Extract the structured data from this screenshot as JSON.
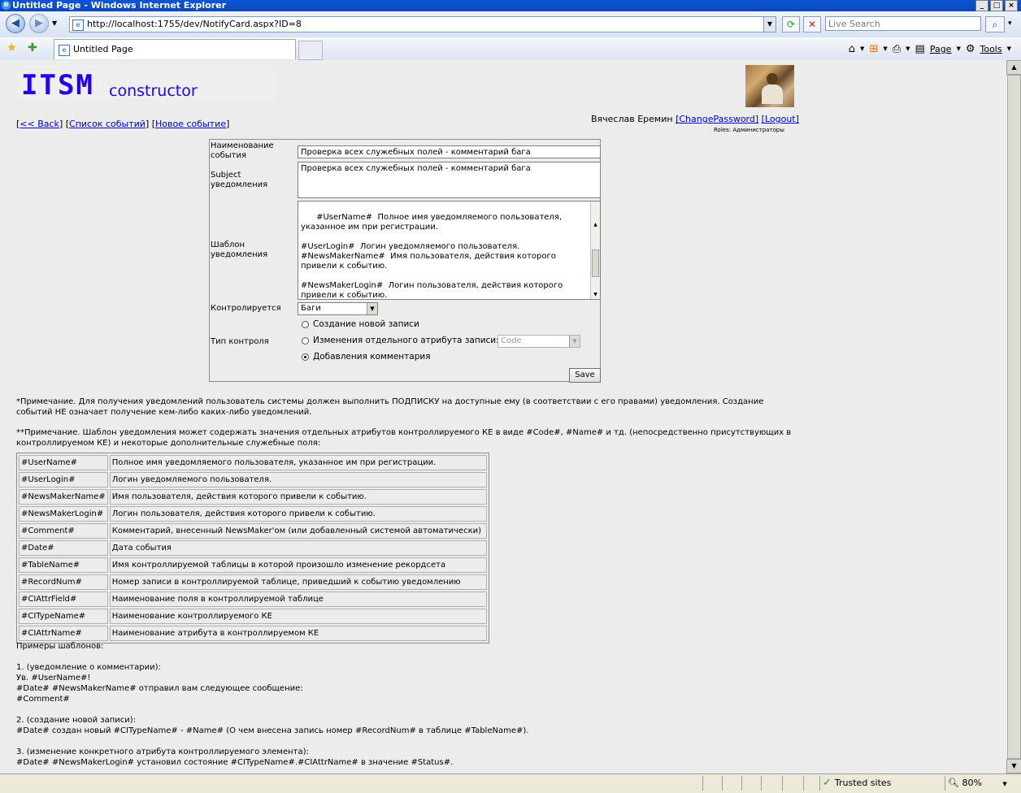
{
  "window": {
    "title": "Untitled Page - Windows Internet Explorer"
  },
  "browser": {
    "address": "http://localhost:1755/dev/NotifyCard.aspx?ID=8",
    "search_placeholder": "Live Search",
    "tab_title": "Untitled Page",
    "commands": {
      "page": "Page",
      "tools": "Tools"
    }
  },
  "status": {
    "zone": "Trusted sites",
    "zoom": "80%"
  },
  "header": {
    "logo_main": "ITSM",
    "logo_sub": "constructor",
    "links": {
      "back": "<< Back",
      "events": "Список событий",
      "new_event": "Новое событие"
    },
    "user": {
      "name": "Вячеслав Еремин",
      "change_password": "[ChangePassword]",
      "logout": "[Logout]",
      "roles": "Roles:  Администраторы"
    }
  },
  "form": {
    "name_label": "Наименование события",
    "name_value": "Проверка всех служебных полей - комментарий бага",
    "subject_label": "Subject уведомления",
    "subject_value": "Проверка всех служебных полей - комментарий бага",
    "template_label": "Шаблон уведомления",
    "template_value": "#UserName#  Полное имя уведомляемого пользователя, указанное им при регистрации.\n\n#UserLogin#  Логин уведомляемого пользователя.\n#NewsMakerName#  Имя пользователя, действия которого привели к событию.\n\n#NewsMakerLogin#  Логин пользователя, действия которого привели к событию.",
    "controlled_label": "Контролируется",
    "controlled_value": "Баги",
    "control_type_label": "Тип контроля",
    "radio_create": "Создание новой записи",
    "radio_attr": "Изменения отдельного атрибута записи:",
    "attr_select": "Code",
    "radio_comment": "Добавления комментария",
    "selected_control_type": "comment",
    "save": "Save"
  },
  "notes": {
    "note1": "*Примечание. Для получения уведомлений пользователь системы должен выполнить ПОДПИСКУ на доступные ему (в соответствии с его правами) уведомления. Создание событий НЕ означает получение кем-либо каких-либо уведомлений.",
    "note2": "**Примечание. Шаблон уведомления может содержать значения отдельных атрибутов контроллируемого КЕ в виде #Code#, #Name# и тд. (непосредственно присутствующих в контроллируемом КЕ) и некоторые дополнительные служебные поля:"
  },
  "fields": [
    [
      "#UserName#",
      "Полное имя уведомляемого пользователя, указанное им при регистрации."
    ],
    [
      "#UserLogin#",
      "Логин уведомляемого пользователя."
    ],
    [
      "#NewsMakerName#",
      "Имя пользователя, действия которого привели к событию."
    ],
    [
      "#NewsMakerLogin#",
      "Логин пользователя, действия которого привели к событию."
    ],
    [
      "#Comment#",
      "Комментарий, внесенный NewsMaker'ом (или добавленный системой автоматически)"
    ],
    [
      "#Date#",
      "Дата события"
    ],
    [
      "#TableName#",
      "Имя контроллируемой таблицы в которой произошло изменение рекордсета"
    ],
    [
      "#RecordNum#",
      "Номер записи в контроллируемой таблице, приведший к событию уведомлению"
    ],
    [
      "#CIAttrField#",
      "Наименование поля в контроллируемой таблице"
    ],
    [
      "#CITypeName#",
      "Наименование контроллируемого КЕ"
    ],
    [
      "#CIAttrName#",
      "Наименование атрибута в контроллируемом КЕ"
    ]
  ],
  "examples": {
    "title": "Примеры шаблонов:",
    "ex1_title": "1. (уведомление о комментарии):",
    "ex1_l1": "Ув. #UserName#!",
    "ex1_l2": "#Date# #NewsMakerName# отправил вам следующее сообщение:",
    "ex1_l3": "#Comment#",
    "ex2_title": "2.  (создание новой записи):",
    "ex2_l1": "#Date# создан новый #CITypeName# - #Name# (О чем внесена запись номер #RecordNum#  в таблице #TableName#).",
    "ex3_title": "3. (изменение конкретного атрибута контроллируемого элемента):",
    "ex3_l1": "#Date# #NewsMakerLogin# установил состояние  #CITypeName#.#CIAttrName# в значение #Status#."
  }
}
